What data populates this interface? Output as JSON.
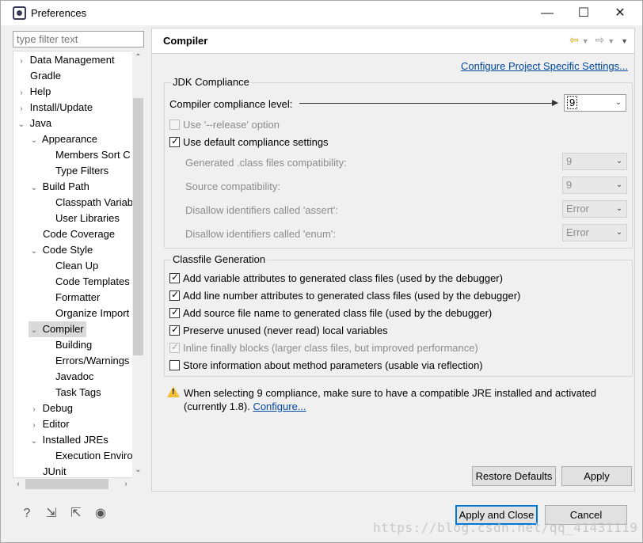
{
  "window": {
    "title": "Preferences",
    "minimize": "—",
    "maximize": "☐",
    "close": "✕"
  },
  "filter": {
    "placeholder": "type filter text"
  },
  "tree": [
    "Data Management",
    "Gradle",
    "Help",
    "Install/Update",
    "Java",
    "Appearance",
    "Members Sort C",
    "Type Filters",
    "Build Path",
    "Classpath Variab",
    "User Libraries",
    "Code Coverage",
    "Code Style",
    "Clean Up",
    "Code Templates",
    "Formatter",
    "Organize Import",
    "Compiler",
    "Building",
    "Errors/Warnings",
    "Javadoc",
    "Task Tags",
    "Debug",
    "Editor",
    "Installed JREs",
    "Execution Enviro",
    "JUnit"
  ],
  "panel": {
    "title": "Compiler",
    "project_link": "Configure Project Specific Settings...",
    "jdk": {
      "group": "JDK Compliance",
      "compliance_label": "Compiler compliance level:",
      "compliance_value": "9",
      "release_option": "Use '--release' option",
      "use_default": "Use default compliance settings",
      "generated_label": "Generated .class files compatibility:",
      "generated_value": "9",
      "source_label": "Source compatibility:",
      "source_value": "9",
      "assert_label": "Disallow identifiers called 'assert':",
      "assert_value": "Error",
      "enum_label": "Disallow identifiers called 'enum':",
      "enum_value": "Error"
    },
    "classfile": {
      "group": "Classfile Generation",
      "opt1": "Add variable attributes to generated class files (used by the debugger)",
      "opt2": "Add line number attributes to generated class files (used by the debugger)",
      "opt3": "Add source file name to generated class file (used by the debugger)",
      "opt4": "Preserve unused (never read) local variables",
      "opt5": "Inline finally blocks (larger class files, but improved performance)",
      "opt6": "Store information about method parameters (usable via reflection)"
    },
    "warning": {
      "line1": "When selecting 9 compliance, make sure to have a compatible JRE installed and activated",
      "line2": "(currently 1.8).",
      "link": "Configure..."
    },
    "restore_defaults": "Restore Defaults",
    "apply": "Apply"
  },
  "footer": {
    "apply_close": "Apply and Close",
    "cancel": "Cancel"
  },
  "watermark": "https://blog.csdn.net/qq_41431119"
}
